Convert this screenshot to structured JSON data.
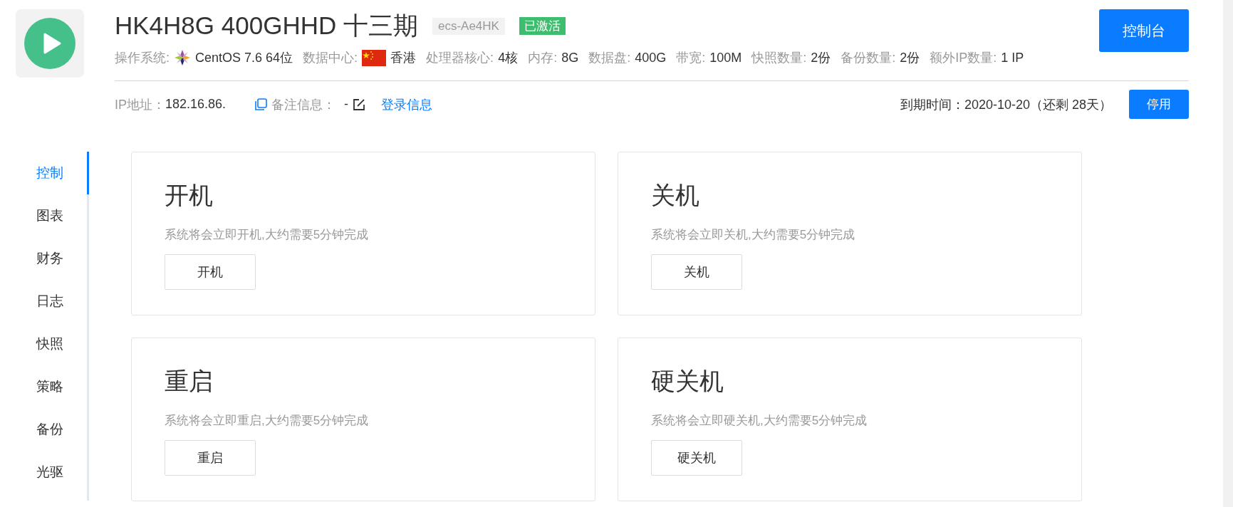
{
  "header": {
    "title": "HK4H8G 400GHHD 十三期",
    "instance_id": "ecs-Ae4HK",
    "status": {
      "label": "已激活",
      "active": true
    },
    "console_button": "控制台",
    "specs": [
      {
        "label": "操作系统:",
        "value": "CentOS 7.6 64位",
        "kind": "os"
      },
      {
        "label": "数据中心:",
        "value": "香港",
        "kind": "flag"
      },
      {
        "label": "处理器核心:",
        "value": "4核",
        "kind": "plain"
      },
      {
        "label": "内存:",
        "value": "8G",
        "kind": "plain"
      },
      {
        "label": "数据盘:",
        "value": "400G",
        "kind": "plain"
      },
      {
        "label": "带宽:",
        "value": "100M",
        "kind": "plain"
      },
      {
        "label": "快照数量:",
        "value": "2份",
        "kind": "plain"
      },
      {
        "label": "备份数量:",
        "value": "2份",
        "kind": "plain"
      },
      {
        "label": "额外IP数量:",
        "value": "1 IP",
        "kind": "plain"
      }
    ],
    "ip_label": "IP地址：",
    "ip_value": "182.16.86.",
    "note_label": "备注信息：",
    "note_value": "-",
    "login_link": "登录信息",
    "expiry": "到期时间：2020-10-20（还剩 28天）",
    "stop_button": "停用"
  },
  "sidebar": {
    "items": [
      {
        "label": "控制",
        "selected": true
      },
      {
        "label": "图表",
        "selected": false
      },
      {
        "label": "财务",
        "selected": false
      },
      {
        "label": "日志",
        "selected": false
      },
      {
        "label": "快照",
        "selected": false
      },
      {
        "label": "策略",
        "selected": false
      },
      {
        "label": "备份",
        "selected": false
      },
      {
        "label": "光驱",
        "selected": false
      }
    ]
  },
  "cards": [
    {
      "title": "开机",
      "description": "系统将会立即开机,大约需要5分钟完成",
      "button": "开机"
    },
    {
      "title": "关机",
      "description": "系统将会立即关机,大约需要5分钟完成",
      "button": "关机"
    },
    {
      "title": "重启",
      "description": "系统将会立即重启,大约需要5分钟完成",
      "button": "重启"
    },
    {
      "title": "硬关机",
      "description": "系统将会立即硬关机,大约需要5分钟完成",
      "button": "硬关机"
    }
  ]
}
